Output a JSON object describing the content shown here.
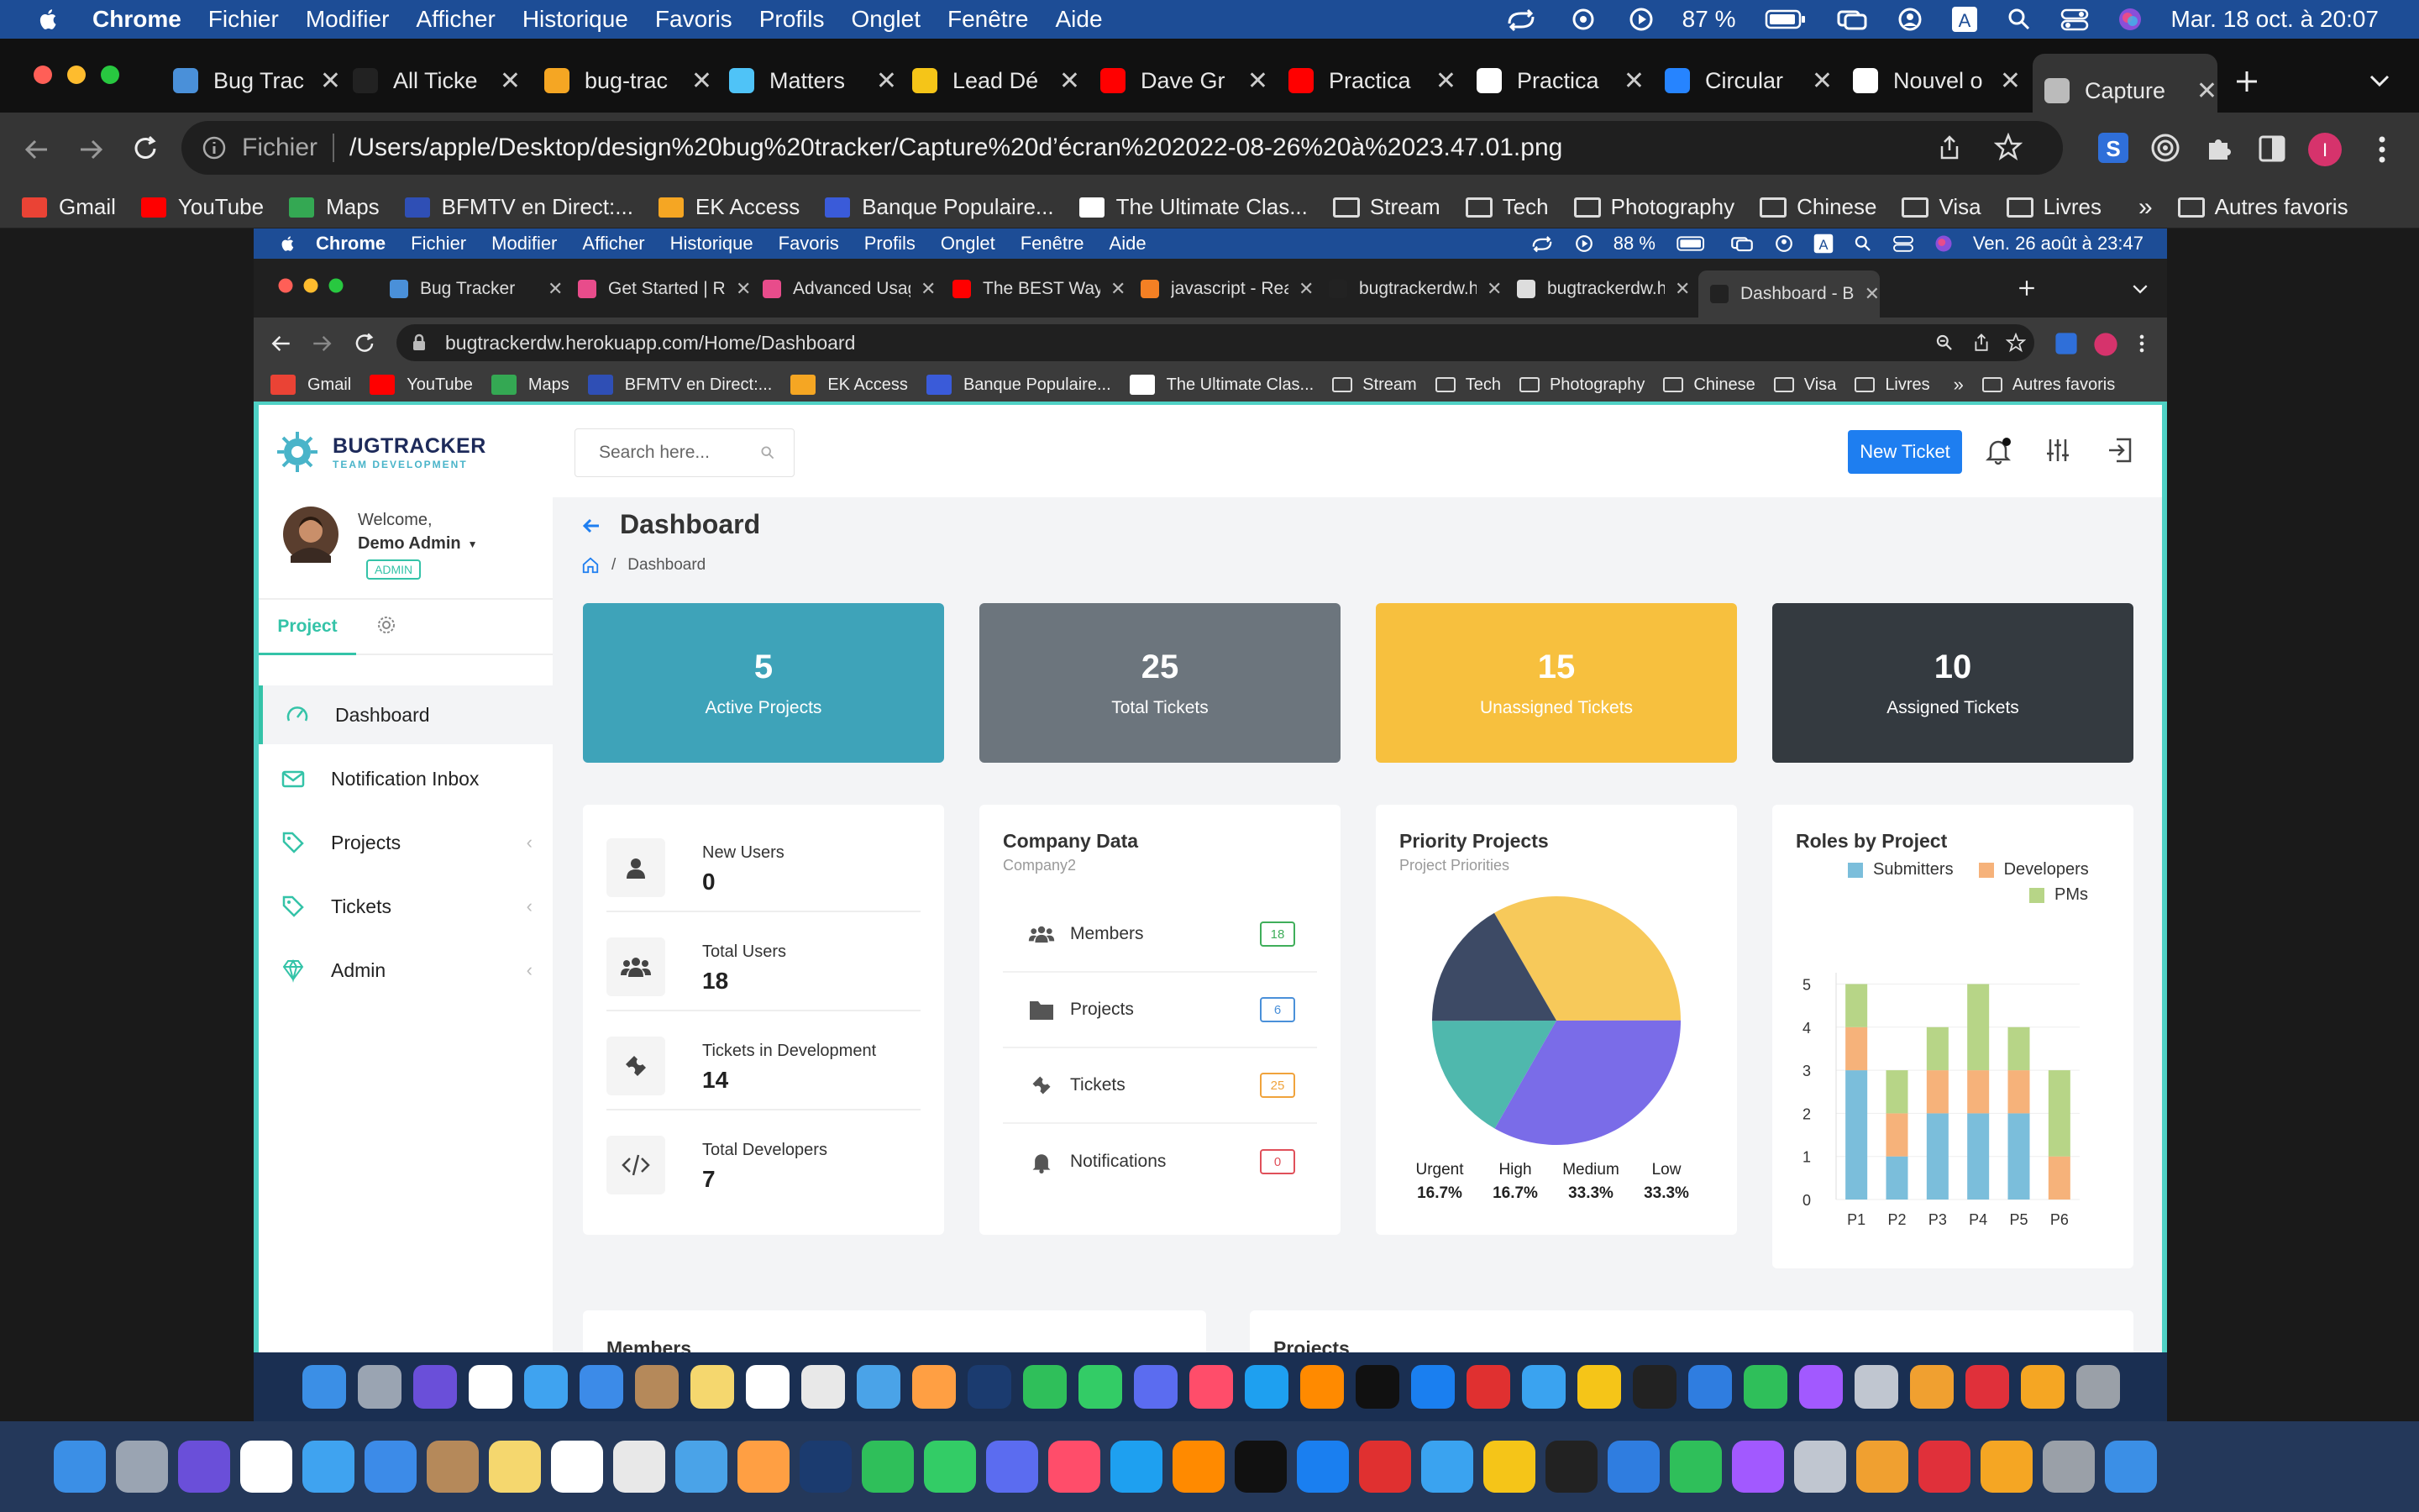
{
  "outer_menubar": {
    "app": "Chrome",
    "items": [
      "Fichier",
      "Modifier",
      "Afficher",
      "Historique",
      "Favoris",
      "Profils",
      "Onglet",
      "Fenêtre",
      "Aide"
    ],
    "battery": "87 %",
    "datetime": "Mar. 18 oct. à  20:07"
  },
  "outer_tabs": [
    {
      "title": "Bug Trac",
      "icon": "bug-tracker-favicon-icon",
      "color": "#4a90d9"
    },
    {
      "title": "All Ticke",
      "icon": "vercel-favicon-icon",
      "color": "#222"
    },
    {
      "title": "bug-trac",
      "icon": "firebase-favicon-icon",
      "color": "#f5a623"
    },
    {
      "title": "Matters",
      "icon": "matters-favicon-icon",
      "color": "#4fc3f7"
    },
    {
      "title": "Lead Dé",
      "icon": "lead-favicon-icon",
      "color": "#f5c518"
    },
    {
      "title": "Dave Gr",
      "icon": "youtube-favicon-icon",
      "color": "#ff0000"
    },
    {
      "title": "Practica",
      "icon": "youtube-favicon-icon",
      "color": "#ff0000"
    },
    {
      "title": "Practica",
      "icon": "github-favicon-icon",
      "color": "#ffffff"
    },
    {
      "title": "Circular",
      "icon": "jira-favicon-icon",
      "color": "#2684ff"
    },
    {
      "title": "Nouvel o",
      "icon": "globe-favicon-icon",
      "color": "#ffffff"
    },
    {
      "title": "Capture",
      "icon": "globe-favicon-icon",
      "color": "#bbbbbb"
    }
  ],
  "outer_url": {
    "prefix": "Fichier",
    "path": "/Users/apple/Desktop/design%20bug%20tracker/Capture%20d’écran%202022-08-26%20à%2023.47.01.png"
  },
  "outer_bookmarks": [
    {
      "label": "Gmail",
      "color": "#ea4335"
    },
    {
      "label": "YouTube",
      "color": "#ff0000"
    },
    {
      "label": "Maps",
      "color": "#34a853"
    },
    {
      "label": "BFMTV en Direct:...",
      "color": "#2f4fb5"
    },
    {
      "label": "EK Access",
      "color": "#f5a623"
    },
    {
      "label": "Banque Populaire...",
      "color": "#3a5bd9"
    },
    {
      "label": "The Ultimate Clas...",
      "color": "#ffffff"
    }
  ],
  "outer_folders": [
    "Stream",
    "Tech",
    "Photography",
    "Chinese",
    "Visa",
    "Livres"
  ],
  "outer_other_bookmarks": "Autres favoris",
  "inner_menubar": {
    "app": "Chrome",
    "items": [
      "Fichier",
      "Modifier",
      "Afficher",
      "Historique",
      "Favoris",
      "Profils",
      "Onglet",
      "Fenêtre",
      "Aide"
    ],
    "battery": "88 %",
    "datetime": "Ven. 26 août à  23:47"
  },
  "inner_tabs": [
    {
      "title": "Bug Tracker",
      "color": "#4a90d9"
    },
    {
      "title": "Get Started | Re",
      "color": "#e84c8b"
    },
    {
      "title": "Advanced Usag",
      "color": "#e84c8b"
    },
    {
      "title": "The BEST Way",
      "color": "#ff0000"
    },
    {
      "title": "javascript - Rea",
      "color": "#f48024"
    },
    {
      "title": "bugtrackerdw.h",
      "color": "#222222"
    },
    {
      "title": "bugtrackerdw.h",
      "color": "#dddddd"
    },
    {
      "title": "Dashboard - Bu",
      "color": "#222222"
    }
  ],
  "inner_url": "bugtrackerdw.herokuapp.com/Home/Dashboard",
  "inner_bookmarks": [
    {
      "label": "Gmail",
      "color": "#ea4335"
    },
    {
      "label": "YouTube",
      "color": "#ff0000"
    },
    {
      "label": "Maps",
      "color": "#34a853"
    },
    {
      "label": "BFMTV en Direct:...",
      "color": "#2f4fb5"
    },
    {
      "label": "EK Access",
      "color": "#f5a623"
    },
    {
      "label": "Banque Populaire...",
      "color": "#3a5bd9"
    },
    {
      "label": "The Ultimate Clas...",
      "color": "#ffffff"
    }
  ],
  "inner_folders": [
    "Stream",
    "Tech",
    "Photography",
    "Chinese",
    "Visa",
    "Livres"
  ],
  "inner_other_bookmarks": "Autres favoris",
  "app": {
    "logo_title": "BUGTRACKER",
    "logo_subtitle": "TEAM DEVELOPMENT",
    "search_placeholder": "Search here...",
    "new_ticket": "New Ticket",
    "user": {
      "welcome": "Welcome,",
      "name": "Demo Admin",
      "role": "ADMIN"
    },
    "sidebar_tab": "Project",
    "nav": [
      {
        "label": "Dashboard",
        "icon": "dashboard-gauge-icon",
        "chevron": false
      },
      {
        "label": "Notification Inbox",
        "icon": "envelope-icon",
        "chevron": false
      },
      {
        "label": "Projects",
        "icon": "tags-icon",
        "chevron": true
      },
      {
        "label": "Tickets",
        "icon": "tag-icon",
        "chevron": true
      },
      {
        "label": "Admin",
        "icon": "gem-icon",
        "chevron": true
      }
    ],
    "page_title": "Dashboard",
    "breadcrumb": "Dashboard",
    "stats": [
      {
        "value": "5",
        "label": "Active Projects",
        "color": "#3ea3b9"
      },
      {
        "value": "25",
        "label": "Total Tickets",
        "color": "#6c757d"
      },
      {
        "value": "15",
        "label": "Unassigned Tickets",
        "color": "#f7c03e"
      },
      {
        "value": "10",
        "label": "Assigned Tickets",
        "color": "#343a40"
      }
    ],
    "user_stats": [
      {
        "label": "New Users",
        "value": "0",
        "icon": "user-icon"
      },
      {
        "label": "Total Users",
        "value": "18",
        "icon": "users-icon"
      },
      {
        "label": "Tickets in Development",
        "value": "14",
        "icon": "ticket-icon"
      },
      {
        "label": "Total Developers",
        "value": "7",
        "icon": "code-icon"
      }
    ],
    "company": {
      "title": "Company Data",
      "subtitle": "Company2",
      "rows": [
        {
          "label": "Members",
          "badge": "18",
          "color": "#3fae5a",
          "icon": "users-icon"
        },
        {
          "label": "Projects",
          "badge": "6",
          "color": "#4a90d9",
          "icon": "folder-icon"
        },
        {
          "label": "Tickets",
          "badge": "25",
          "color": "#f0a33c",
          "icon": "ticket-icon"
        },
        {
          "label": "Notifications",
          "badge": "0",
          "color": "#e0505a",
          "icon": "bell-icon"
        }
      ]
    },
    "bottom_sections": [
      "Members",
      "Projects"
    ]
  },
  "chart_data": [
    {
      "type": "pie",
      "title": "Priority Projects",
      "subtitle": "Project Priorities",
      "categories": [
        "Urgent",
        "High",
        "Medium",
        "Low"
      ],
      "values": [
        16.7,
        16.7,
        33.3,
        33.3
      ],
      "labels": [
        "16.7%",
        "16.7%",
        "33.3%",
        "33.3%"
      ],
      "colors": [
        "#3d4a65",
        "#4fb8ad",
        "#7a6ce8",
        "#f7c95a"
      ]
    },
    {
      "type": "bar",
      "stacked": true,
      "title": "Roles by Project",
      "categories": [
        "P1",
        "P2",
        "P3",
        "P4",
        "P5",
        "P6"
      ],
      "series": [
        {
          "name": "Submitters",
          "values": [
            3,
            1,
            2,
            2,
            2,
            0
          ],
          "color": "#7bbedb"
        },
        {
          "name": "Developers",
          "values": [
            1,
            1,
            1,
            1,
            1,
            1
          ],
          "color": "#f6b27a"
        },
        {
          "name": "PMs",
          "values": [
            1,
            1,
            1,
            2,
            1,
            2
          ],
          "color": "#b7d587"
        }
      ],
      "ylim": [
        0,
        5
      ],
      "yticks": [
        0,
        1,
        2,
        3,
        4,
        5
      ],
      "legend": "top"
    }
  ]
}
